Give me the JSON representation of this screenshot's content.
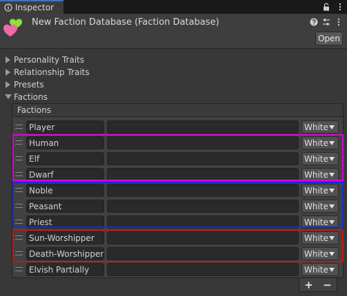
{
  "window": {
    "tab_title": "Inspector",
    "tab_icon": "inspector-info-icon",
    "actions": [
      "lock-icon",
      "more-options-icon"
    ]
  },
  "header": {
    "title": "New Faction Database (Faction Database)",
    "asset_icon": "hearts-asset-icon",
    "icons": [
      "help-icon",
      "presets-icon",
      "more-options-icon"
    ],
    "open_label": "Open"
  },
  "foldouts": [
    {
      "label": "Personality Traits",
      "expanded": false
    },
    {
      "label": "Relationship Traits",
      "expanded": false
    },
    {
      "label": "Presets",
      "expanded": false
    },
    {
      "label": "Factions",
      "expanded": true
    }
  ],
  "factions_list": {
    "header": "Factions",
    "items": [
      {
        "name": "Player",
        "description": "",
        "color": "White"
      },
      {
        "name": "Human",
        "description": "",
        "color": "White"
      },
      {
        "name": "Elf",
        "description": "",
        "color": "White"
      },
      {
        "name": "Dwarf",
        "description": "",
        "color": "White"
      },
      {
        "name": "Noble",
        "description": "",
        "color": "White"
      },
      {
        "name": "Peasant",
        "description": "",
        "color": "White"
      },
      {
        "name": "Priest",
        "description": "",
        "color": "White"
      },
      {
        "name": "Sun-Worshipper",
        "description": "",
        "color": "White"
      },
      {
        "name": "Death-Worshipper",
        "description": "",
        "color": "White"
      },
      {
        "name": "Elvish Partially",
        "description": "",
        "color": "White"
      }
    ],
    "add_label": "+",
    "remove_label": "−"
  },
  "highlight_groups": [
    {
      "color": "#e000e0"
    },
    {
      "color": "#1030d8"
    },
    {
      "color": "#d01010"
    }
  ],
  "colors": {
    "tab_accent": "#3a79bb",
    "background": "#383838",
    "field": "#2a2a2a"
  }
}
